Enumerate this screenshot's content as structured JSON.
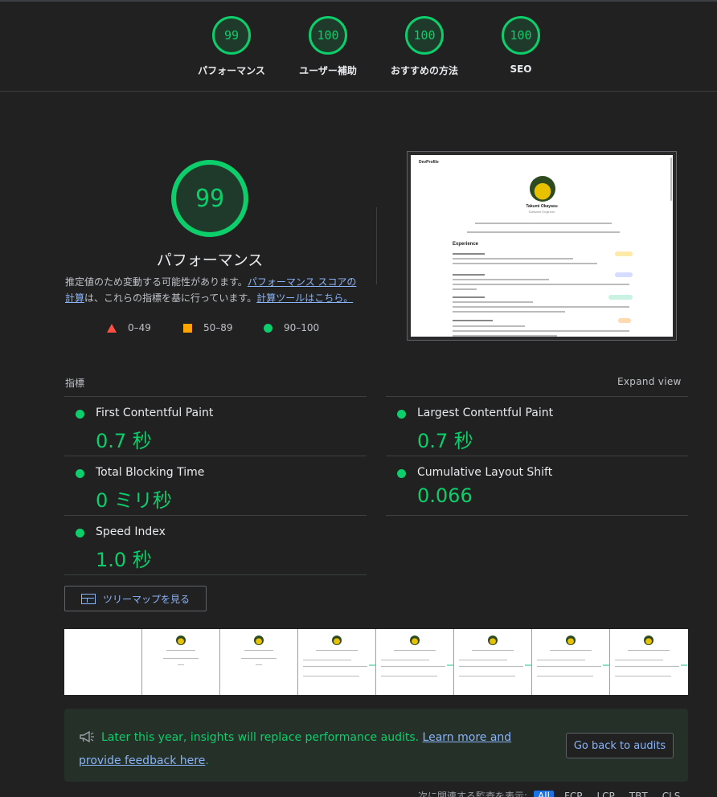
{
  "top_scores": [
    {
      "score": "99",
      "label": "パフォーマンス"
    },
    {
      "score": "100",
      "label": "ユーザー補助"
    },
    {
      "score": "100",
      "label": "おすすめの方法"
    },
    {
      "score": "100",
      "label": "SEO"
    }
  ],
  "performance": {
    "score": "99",
    "title": "パフォーマンス",
    "desc_part1": "推定値のため変動する可能性があります。",
    "desc_link1": "パフォーマンス スコアの計算",
    "desc_part2": "は、これらの指標を基に行っています。",
    "desc_link2": "計算ツールはこちら。"
  },
  "legend": {
    "fail": "0–49",
    "average": "50–89",
    "pass": "90–100"
  },
  "screenshot_preview": {
    "brand": "DevProfile",
    "name": "Takumi Okayasu",
    "role": "Software Engineer"
  },
  "metrics": {
    "header": "指標",
    "expand_label": "Expand view",
    "items": [
      {
        "title": "First Contentful Paint",
        "value": "0.7 秒"
      },
      {
        "title": "Largest Contentful Paint",
        "value": "0.7 秒"
      },
      {
        "title": "Total Blocking Time",
        "value": "0 ミリ秒"
      },
      {
        "title": "Cumulative Layout Shift",
        "value": "0.066"
      },
      {
        "title": "Speed Index",
        "value": "1.0 秒"
      }
    ],
    "treemap_label": "ツリーマップを見る"
  },
  "banner": {
    "text": "Later this year, insights will replace performance audits. ",
    "link": "Learn more and provide feedback here",
    "period": ".",
    "button": "Go back to audits"
  },
  "filter": {
    "label": "次に関連する監査を表示:",
    "chips": [
      "All",
      "FCP",
      "LCP",
      "TBT",
      "CLS"
    ]
  },
  "colors": {
    "pass": "#0cce6b",
    "average": "#ffa400",
    "fail": "#ff4e42",
    "link": "#8ab4f8",
    "background": "#212121"
  }
}
